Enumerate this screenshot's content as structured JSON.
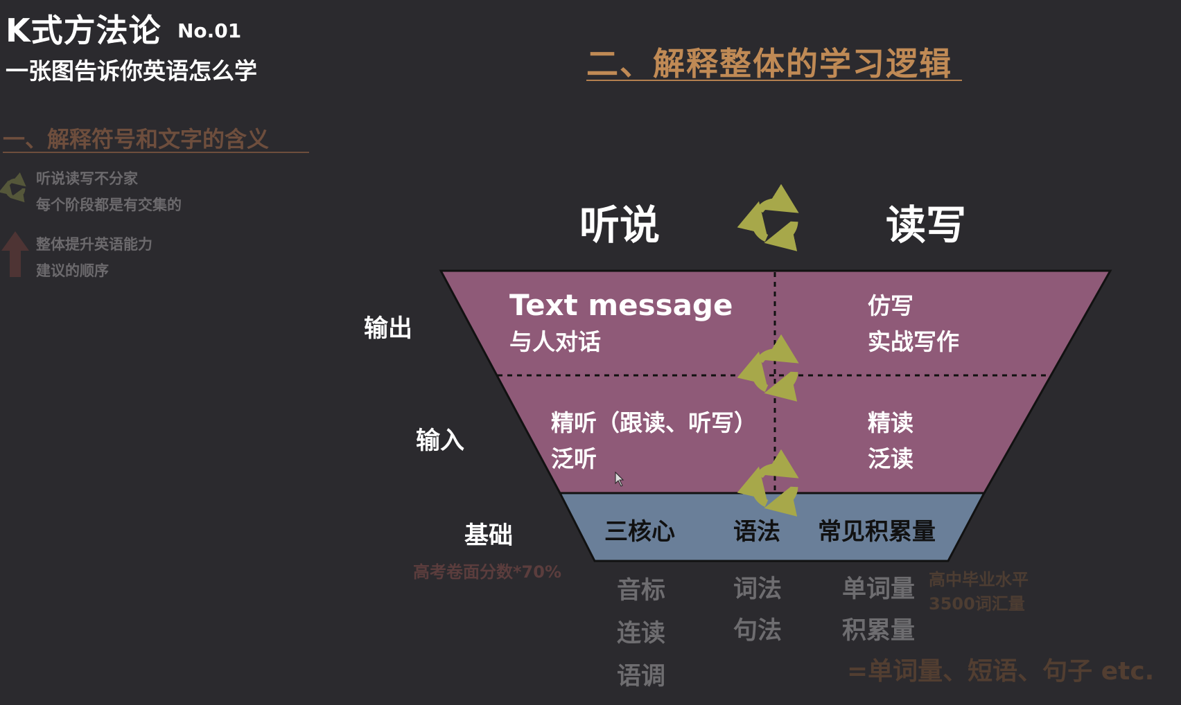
{
  "header": {
    "brand": "K式方法论",
    "brand_no": "No.01",
    "subtitle": "一张图告诉你英语怎么学"
  },
  "section1": {
    "title": "一、解释符号和文字的含义",
    "legend": [
      {
        "icon": "recycle-arrows-icon",
        "line1": "听说读写不分家",
        "line2": "每个阶段都是有交集的"
      },
      {
        "icon": "up-arrow-icon",
        "line1": "整体提升英语能力",
        "line2": "建议的顺序"
      }
    ]
  },
  "section2": {
    "title": "二、解释整体的学习逻辑"
  },
  "diagram": {
    "col_left": "听说",
    "col_right": "读写",
    "rows": {
      "output": "输出",
      "input": "输入",
      "base": "基础"
    },
    "output_left_en": "Text message",
    "output_left_cn": "与人对话",
    "output_right_1": "仿写",
    "output_right_2": "实战写作",
    "input_left_1": "精听（跟读、听写）",
    "input_left_2": "泛听",
    "input_right_1": "精读",
    "input_right_2": "泛读",
    "base_1": "三核心",
    "base_2": "语法",
    "base_3": "常见积累量",
    "base_note": "高考卷面分数*70%",
    "core_items": [
      "音标",
      "连读",
      "语调"
    ],
    "grammar_items": [
      "词法",
      "句法"
    ],
    "vocab_items": [
      "单词量",
      "积累量"
    ],
    "vocab_note_1": "高中毕业水平",
    "vocab_note_2": "3500词汇量",
    "vocab_formula": "=单词量、短语、句子 etc.",
    "colors": {
      "funnel_top": "#8f5a78",
      "funnel_base": "#6a7f99",
      "recycle": "#a7a84a",
      "accent": "#c08a55"
    }
  }
}
